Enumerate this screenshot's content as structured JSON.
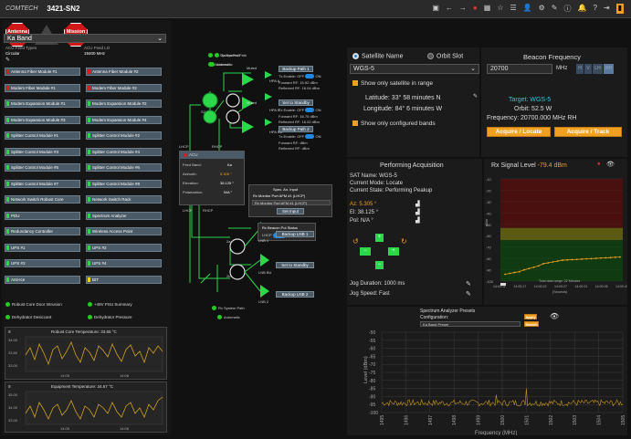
{
  "topbar": {
    "logo": "COMTECH",
    "title": "3421-SN2"
  },
  "alarms": {
    "antenna_stop": "Antenna\nStop",
    "mission_mute": "Mission\nMute"
  },
  "band": {
    "selected": "Ka Band",
    "acu_feed_types_label": "ACU Feed Types",
    "acu_feed_types_value": "Circular",
    "acu_feed_lo_label": "ACU Feed LO",
    "acu_feed_lo_value": "19400 MHz"
  },
  "modules": [
    {
      "label": "Antenna Fiber Module #1",
      "color": "#d02020"
    },
    {
      "label": "Antenna Fiber Module #2",
      "color": "#d02020"
    },
    {
      "label": "Modem Fiber Module #1",
      "color": "#d02020"
    },
    {
      "label": "Modem Fiber Module #2",
      "color": "#d02020"
    },
    {
      "label": "Modem Expansion Module #1",
      "color": "#2cd84a"
    },
    {
      "label": "Modem Expansion Module #2",
      "color": "#2cd84a"
    },
    {
      "label": "Modem Expansion Module #3",
      "color": "#2cd84a"
    },
    {
      "label": "Modem Expansion Module #4",
      "color": "#2cd84a"
    },
    {
      "label": "Splitter Control Module #1",
      "color": "#2cd84a"
    },
    {
      "label": "Splitter Control Module #2",
      "color": "#2cd84a"
    },
    {
      "label": "Splitter Control Module #3",
      "color": "#2cd84a"
    },
    {
      "label": "Splitter Control Module #4",
      "color": "#2cd84a"
    },
    {
      "label": "Splitter Control Module #5",
      "color": "#2cd84a"
    },
    {
      "label": "Splitter Control Module #6",
      "color": "#2cd84a"
    },
    {
      "label": "Splitter Control Module #7",
      "color": "#2cd84a"
    },
    {
      "label": "Splitter Control Module #8",
      "color": "#2cd84a"
    },
    {
      "label": "Network Switch Robust Core",
      "color": "#2cd84a"
    },
    {
      "label": "Network Switch Rack",
      "color": "#2cd84a"
    },
    {
      "label": "PDU",
      "color": "#2cd84a"
    },
    {
      "label": "Spectrum Analyzer",
      "color": "#2cd84a"
    },
    {
      "label": "Redundancy Controller",
      "color": "#2cd84a"
    },
    {
      "label": "Wireless Access Point",
      "color": "#2cd84a"
    },
    {
      "label": "UPS #1",
      "color": "#2cd84a"
    },
    {
      "label": "UPS #2",
      "color": "#2cd84a"
    },
    {
      "label": "UPS #3",
      "color": "#2cd84a"
    },
    {
      "label": "UPS #4",
      "color": "#2cd84a"
    },
    {
      "label": "Anti-Ice",
      "color": "#2cd84a"
    },
    {
      "label": "BIT",
      "color": "#f0d020"
    }
  ],
  "status_items": [
    "Robust Core Door Intrusion",
    "+48V PSU Summary",
    "Dehydrator Desiccant",
    "Dehydrator Pressure"
  ],
  "temps": {
    "robust_core": "Robust Core Temperature: 33.65 °C",
    "equipment": "Equipment Temperature: 34.67 °C",
    "rc_ticks": [
      "34.00",
      "33.50",
      "33.00"
    ],
    "eq_ticks": [
      "35.00",
      "34.00",
      "33.00"
    ],
    "x_ticks": [
      "14:05",
      "14:06"
    ]
  },
  "diagram": {
    "tx_system_path": "Tx System Path",
    "automatic": "Automatic",
    "muted": "Muted",
    "hpa_a": "HPA A",
    "hpa_b": "HPA B",
    "hpa_bu": "HPA BU",
    "backup_path_1": "Backup Path 1",
    "set_to_standby": "Set to Standby",
    "backup_path_2": "Backup Path 2",
    "tx_enable": "Tx Enable:",
    "off": "OFF",
    "on": "ON",
    "fwd_rf": "Forward RF: 15.92 dBm",
    "rfl_rf": "Reflected RF: 16.04 dBm",
    "fwd_rf2": "Forward RF: 16.75 dBm",
    "rfl_rf2": "Reflected RF: 16.02 dBm",
    "fwd_rf3": "Forward RF: dBm",
    "rfl_rf3": "Reflected RF: dBm",
    "lhcp": "LHCP",
    "rhcp": "RHCP",
    "acu_title": "ACU",
    "feed_band": "Feed Band:",
    "feed_band_val": "Ka",
    "azimuth": "Azimuth:",
    "azimuth_val": "5.305 °",
    "elevation": "Elevation:",
    "elevation_val": "38.125 °",
    "polarization": "Polarization:",
    "polarization_val": "N/A °",
    "spec_an_input": "Spec. An. Input",
    "rx_monitor": "Rx Monitor Port AFM #1 (LHCP)",
    "rx_monitor_sel": "Rx Monitor Port AFM #1 (LHCP)",
    "set_input": "Set Input",
    "rx_beacon": "Rx Beacon Pol Status",
    "backup_lnb1": "Backup LNB 1",
    "backup_lnb2": "Backup LNB 2",
    "lnb1": "LNB 1",
    "lnb2": "LNB 2",
    "lnb_bu": "LNB BU",
    "rx_system_path": "Rx System Path",
    "automatic2": "Automatic",
    "pa": "2a",
    "pb": "2b"
  },
  "satellite": {
    "name_label": "Satellite Name",
    "orbit_label": "Orbit Slot",
    "selected": "WGS-5",
    "show_in_range": "Show only satellite in range",
    "latitude": "Latitude: 33° 58 minutes N",
    "longitude": "Longitude: 84° 6 minutes W",
    "show_configured": "Show only configured bands"
  },
  "beacon": {
    "title": "Beacon Frequency",
    "value": "20700",
    "unit": "MHz",
    "pols": [
      "H",
      "V",
      "LH",
      "RH"
    ],
    "target": "Target: WGS-5",
    "orbit": "Orbit: 52.5 W",
    "frequency": "Frequency: 20700.000 MHz RH",
    "acquire_locate": "Acquire / Locate",
    "acquire_track": "Acquire / Track"
  },
  "acquisition": {
    "title": "Performing Acquisition",
    "sat_name": "SAT Name: WGS-5",
    "mode": "Current Mode: Locate",
    "state": "Current State: Performing Peakup",
    "az": "Az: 5.305 °",
    "el": "El: 38.125 °",
    "pol": "Pol: N/A °",
    "jog_duration": "Jog Duration: 1000 ms",
    "jog_speed": "Jog Speed: Fast"
  },
  "rx_signal": {
    "title": "Rx Signal Level",
    "value": "-79.4 dBm",
    "ylabel": "dBm",
    "yticks": [
      "-10",
      "-20",
      "-30",
      "-40",
      "-50",
      "-60",
      "-70",
      "-80",
      "-90",
      "-100"
    ],
    "xticks": [
      "14:00:11",
      "14:05:17",
      "14:00:22",
      "14:00:27",
      "14:00:31",
      "14:00:36",
      "14:00:41"
    ],
    "caption": "Total data range: 22 Minutes",
    "xunit": "(Seconds)"
  },
  "spectrum": {
    "title": "Spectrum Analyzer Presets",
    "config_label": "Configuration:",
    "config_value": "Ka Band Preset",
    "apply": "Apply",
    "search": "Search",
    "ylabel": "Level (dBm)",
    "xlabel": "Frequency (MHz)",
    "yticks": [
      "-50",
      "-55",
      "-60",
      "-65",
      "-70",
      "-75",
      "-80",
      "-85",
      "-90",
      "-95",
      "-100"
    ],
    "xticks": [
      "1495",
      "1496",
      "1497",
      "1498",
      "1499",
      "1500",
      "1501",
      "1502",
      "1503",
      "1504",
      "1505"
    ]
  }
}
